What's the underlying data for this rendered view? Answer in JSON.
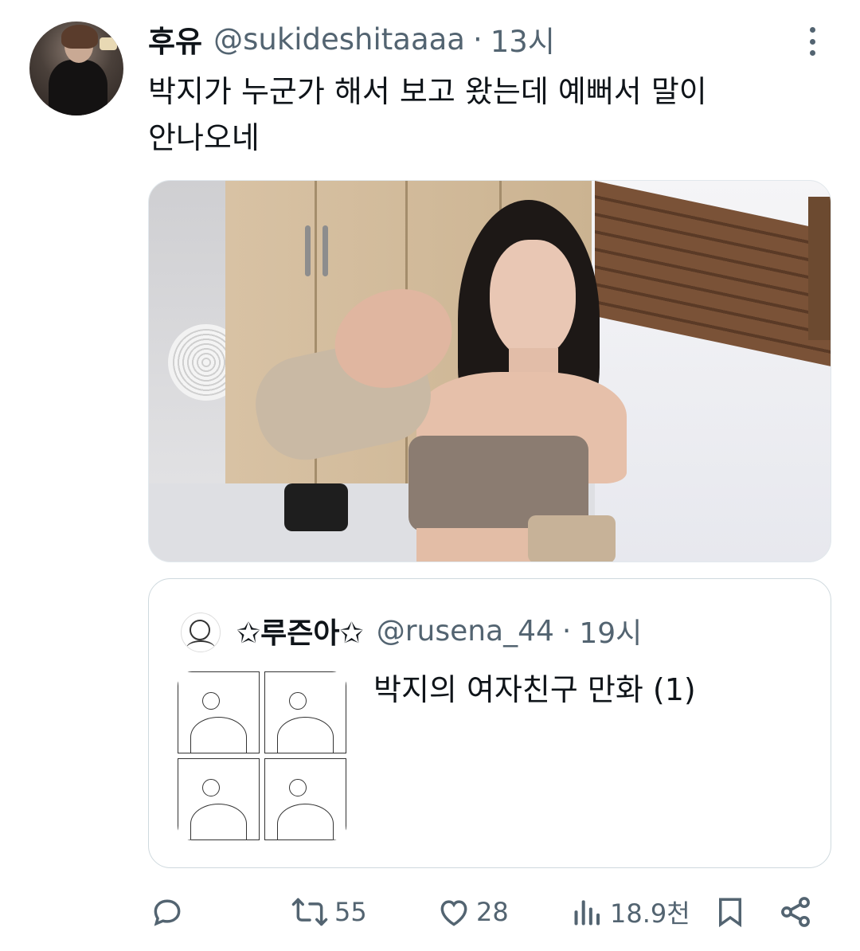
{
  "tweet": {
    "author_name": "후유",
    "handle": "@sukideshitaaaa",
    "separator": "·",
    "time": "13시",
    "text_line1": "박지가 누군가 해서 보고 왔는데 예뻐서 말이",
    "text_line2": "안나오네"
  },
  "quote": {
    "author_name": "✩루즌아✩",
    "handle": "@rusena_44",
    "separator": "·",
    "time": "19시",
    "text": "박지의 여자친구 만화 (1)"
  },
  "actions": {
    "reply_icon": "reply-icon",
    "retweet_count": "55",
    "like_count": "28",
    "views_count": "18.9천"
  },
  "colors": {
    "text_primary": "#0f1419",
    "text_secondary": "#536471",
    "border": "#cfd9de"
  }
}
